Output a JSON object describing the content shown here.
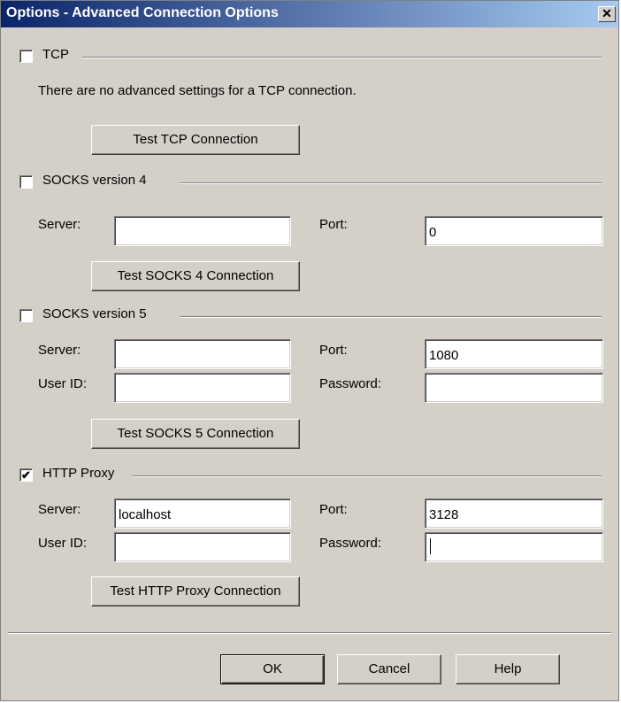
{
  "window": {
    "title": "Options - Advanced Connection Options",
    "close_glyph": "✕"
  },
  "tcp": {
    "label": "TCP",
    "checked": false,
    "info": "There are no advanced settings for a TCP connection.",
    "test_button": "Test TCP Connection"
  },
  "socks4": {
    "label": "SOCKS version 4",
    "checked": false,
    "server_label": "Server:",
    "server_value": "",
    "port_label": "Port:",
    "port_value": "0",
    "test_button": "Test SOCKS 4 Connection"
  },
  "socks5": {
    "label": "SOCKS version 5",
    "checked": false,
    "server_label": "Server:",
    "server_value": "",
    "port_label": "Port:",
    "port_value": "1080",
    "userid_label": "User ID:",
    "userid_value": "",
    "password_label": "Password:",
    "password_value": "",
    "test_button": "Test SOCKS 5 Connection"
  },
  "http": {
    "label": "HTTP Proxy",
    "checked": true,
    "server_label": "Server:",
    "server_value": "localhost",
    "port_label": "Port:",
    "port_value": "3128",
    "userid_label": "User ID:",
    "userid_value": "",
    "password_label": "Password:",
    "password_value": "",
    "test_button": "Test HTTP Proxy Connection"
  },
  "footer": {
    "ok": "OK",
    "cancel": "Cancel",
    "help": "Help"
  },
  "check_glyph": "✔"
}
